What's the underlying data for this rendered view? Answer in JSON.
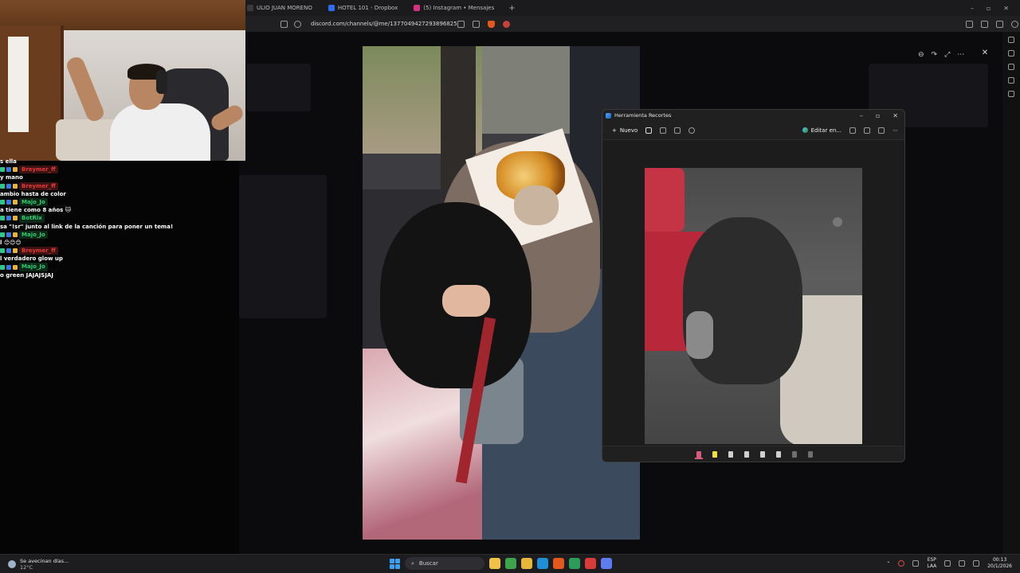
{
  "browser": {
    "tabs": [
      {
        "label": "ULIO JUAN MORENO",
        "color": "#3a3a3a"
      },
      {
        "label": "HOTEL 101 - Dropbox",
        "color": "#2f6cf0"
      },
      {
        "label": "(5) Instagram • Mensajes",
        "color": "#d6327f"
      }
    ],
    "new_tab": "+",
    "url": "discord.com/channels/@me/1377049427293896825",
    "window_controls": [
      "–",
      "▫",
      "✕"
    ]
  },
  "viewer": {
    "tools": [
      "⊖",
      "↷",
      "⤢",
      "⋯"
    ],
    "close": "✕"
  },
  "chat": {
    "rows": [
      {
        "type": "msg",
        "text": "s ella"
      },
      {
        "type": "user",
        "name": "Breymer_ff",
        "color": "#e23b3b"
      },
      {
        "type": "msg",
        "text": "y mano"
      },
      {
        "type": "user",
        "name": "Breymer_ff",
        "color": "#e23b3b"
      },
      {
        "type": "msg",
        "text": "ambio hasta de color"
      },
      {
        "type": "user",
        "name": "Majo_Jo",
        "color": "#2ecc71"
      },
      {
        "type": "msg",
        "text": "a tiene como 8 años 🐱"
      },
      {
        "type": "user",
        "name": "BotRix",
        "color": "#2ecc71"
      },
      {
        "type": "msg",
        "text": "sa \"!sr\" junto al link de la canción para poner un tema!"
      },
      {
        "type": "user",
        "name": "Majo_Jo",
        "color": "#2ecc71"
      },
      {
        "type": "msg",
        "text": "l 😊😊😊"
      },
      {
        "type": "user",
        "name": "Breymer_ff",
        "color": "#e23b3b"
      },
      {
        "type": "msg",
        "text": "l verdadero glow up"
      },
      {
        "type": "user",
        "name": "Majo_Jo",
        "color": "#2ecc71"
      },
      {
        "type": "msg",
        "text": "o green JAJAJSJAJ"
      }
    ]
  },
  "snipping_tool": {
    "title": "Herramienta Recortes",
    "new_label": "Nuevo",
    "edit_label": "Editar en...",
    "window_controls": [
      "–",
      "▫",
      "✕"
    ],
    "bottom_tools": [
      {
        "name": "ballpoint-pen-icon",
        "color": "#d85a7f",
        "selected": true
      },
      {
        "name": "highlighter-icon",
        "color": "#f0e040",
        "selected": false
      },
      {
        "name": "eraser-icon",
        "color": "#cfcfcf",
        "selected": false
      },
      {
        "name": "shapes-icon",
        "color": "#cfcfcf",
        "selected": false
      },
      {
        "name": "crop-icon",
        "color": "#cfcfcf",
        "selected": false
      },
      {
        "name": "text-actions-icon",
        "color": "#cfcfcf",
        "selected": false
      },
      {
        "name": "undo-icon",
        "color": "#6f6f6f",
        "selected": false
      },
      {
        "name": "redo-icon",
        "color": "#6f6f6f",
        "selected": false
      }
    ]
  },
  "taskbar": {
    "weather_title": "Se avecinan días...",
    "weather_temp": "12°C",
    "search_placeholder": "Buscar",
    "lang_top": "ESP",
    "lang_bottom": "LAA",
    "time": "00:13",
    "date": "20/1/2026",
    "apps": [
      {
        "name": "file-explorer-icon",
        "color": "#f1c24a"
      },
      {
        "name": "chrome-icon",
        "color": "#3fa34d"
      },
      {
        "name": "folder-icon",
        "color": "#e7b73a"
      },
      {
        "name": "edge-icon",
        "color": "#1f8fd6"
      },
      {
        "name": "brave-icon",
        "color": "#e2591f"
      },
      {
        "name": "spreadsheet-icon",
        "color": "#2d9c5a"
      },
      {
        "name": "browser-icon",
        "color": "#d93a3a"
      },
      {
        "name": "snipping-tool-icon",
        "color": "#5c7cf0"
      }
    ]
  }
}
